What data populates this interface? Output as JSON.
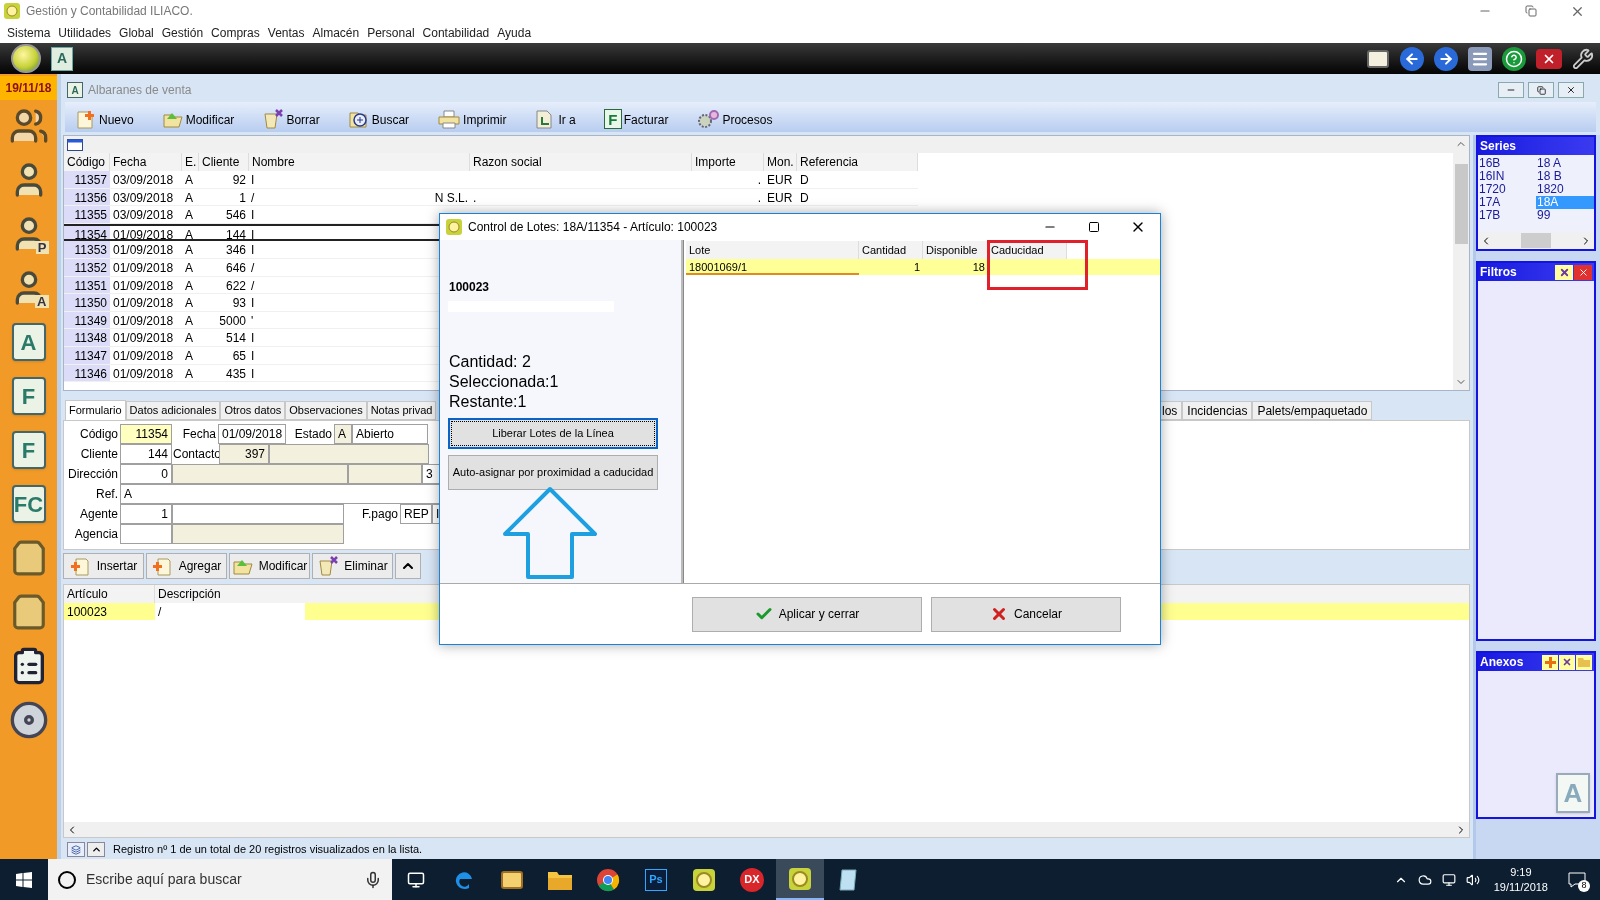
{
  "app_window": {
    "title": "Gestión y Contabilidad ILIACO."
  },
  "menu": [
    "Sistema",
    "Utilidades",
    "Global",
    "Gestión",
    "Compras",
    "Ventas",
    "Almacén",
    "Personal",
    "Contabilidad",
    "Ayuda"
  ],
  "quick_bar": {
    "module_glyph": "A"
  },
  "sidebar": {
    "date": "19/11/18",
    "items": [
      {
        "kind": "people"
      },
      {
        "kind": "person"
      },
      {
        "kind": "person",
        "glyph": "P"
      },
      {
        "kind": "person",
        "glyph": "A"
      },
      {
        "kind": "letter",
        "glyph": "A"
      },
      {
        "kind": "letter",
        "glyph": "F"
      },
      {
        "kind": "letter",
        "glyph": "F"
      },
      {
        "kind": "letter",
        "glyph": "FC"
      },
      {
        "kind": "bag"
      },
      {
        "kind": "bag"
      },
      {
        "kind": "list"
      },
      {
        "kind": "disc"
      }
    ]
  },
  "window": {
    "icon_glyph": "A",
    "title": "Albaranes de venta",
    "toolbar": [
      {
        "label": "Nuevo",
        "kind": "new"
      },
      {
        "label": "Modificar",
        "kind": "edit"
      },
      {
        "label": "Borrar",
        "kind": "delete"
      },
      {
        "label": "Buscar",
        "kind": "search"
      },
      {
        "label": "Imprimir",
        "kind": "print"
      },
      {
        "label": "Ir a",
        "kind": "goto"
      },
      {
        "label": "Facturar",
        "kind": "letter",
        "glyph": "F"
      },
      {
        "label": "Procesos",
        "kind": "process"
      }
    ]
  },
  "list": {
    "columns": [
      "Código",
      "Fecha",
      "E.",
      "Cliente",
      "Nombre",
      "Razon social",
      "Importe",
      "Mon.",
      "Referencia"
    ],
    "rows": [
      {
        "codigo": "11357",
        "fecha": "03/09/2018",
        "e": "A",
        "cliente": "92",
        "nombre": "I",
        "importe": ".",
        "mon": "EUR",
        "referencia": "D",
        "selected": false
      },
      {
        "codigo": "11356",
        "fecha": "03/09/2018",
        "e": "A",
        "cliente": "1",
        "nombre": "/",
        "nombre_tail": "N S.L.",
        "razon_social": ".",
        "importe": ".",
        "mon": "EUR",
        "referencia": "D",
        "selected": false
      },
      {
        "codigo": "11355",
        "fecha": "03/09/2018",
        "e": "A",
        "cliente": "546",
        "nombre": "I",
        "selected": false
      },
      {
        "codigo": "11354",
        "fecha": "01/09/2018",
        "e": "A",
        "cliente": "144",
        "nombre": "I",
        "selected": true
      },
      {
        "codigo": "11353",
        "fecha": "01/09/2018",
        "e": "A",
        "cliente": "346",
        "nombre": "I",
        "selected": false
      },
      {
        "codigo": "11352",
        "fecha": "01/09/2018",
        "e": "A",
        "cliente": "646",
        "nombre": "/",
        "selected": false
      },
      {
        "codigo": "11351",
        "fecha": "01/09/2018",
        "e": "A",
        "cliente": "622",
        "nombre": "/",
        "selected": false
      },
      {
        "codigo": "11350",
        "fecha": "01/09/2018",
        "e": "A",
        "cliente": "93",
        "nombre": "I",
        "selected": false
      },
      {
        "codigo": "11349",
        "fecha": "01/09/2018",
        "e": "A",
        "cliente": "5000",
        "nombre": "'",
        "selected": false
      },
      {
        "codigo": "11348",
        "fecha": "01/09/2018",
        "e": "A",
        "cliente": "514",
        "nombre": "I",
        "selected": false
      },
      {
        "codigo": "11347",
        "fecha": "01/09/2018",
        "e": "A",
        "cliente": "65",
        "nombre": "I",
        "selected": false
      },
      {
        "codigo": "11346",
        "fecha": "01/09/2018",
        "e": "A",
        "cliente": "435",
        "nombre": "I",
        "selected": false
      }
    ]
  },
  "series": {
    "title": "Series",
    "items": [
      {
        "label": "16B",
        "selected": false
      },
      {
        "label": "16IN",
        "selected": false
      },
      {
        "label": "1720",
        "selected": false
      },
      {
        "label": "17A",
        "selected": false
      },
      {
        "label": "17B",
        "selected": false
      },
      {
        "label": "18 A",
        "selected": false
      },
      {
        "label": "18 B",
        "selected": false
      },
      {
        "label": "1820",
        "selected": false
      },
      {
        "label": "18A",
        "selected": true
      },
      {
        "label": "99",
        "selected": false
      }
    ]
  },
  "filters": {
    "title": "Filtros"
  },
  "attachments": {
    "title": "Anexos",
    "glyph": "A"
  },
  "form": {
    "tabs_left": [
      {
        "label": "Formulario",
        "selected": true
      },
      {
        "label": "Datos adicionales",
        "selected": false
      },
      {
        "label": "Otros datos",
        "selected": false
      },
      {
        "label": "Observaciones",
        "selected": false
      },
      {
        "label": "Notas privad",
        "selected": false
      }
    ],
    "tabs_right": [
      {
        "label": "los",
        "selected": false
      },
      {
        "label": "Incidencias",
        "selected": false
      },
      {
        "label": "Palets/empaquetado",
        "selected": false
      }
    ],
    "codigo_label": "Código",
    "codigo": "11354",
    "fecha_label": "Fecha",
    "fecha": "01/09/2018",
    "estado_label": "Estado",
    "estado": "A",
    "estado_text": "Abierto",
    "cliente_label": "Cliente",
    "cliente": "144",
    "contacto_label": "Contacto",
    "contacto": "397",
    "direccion_label": "Dirección",
    "direccion": "0",
    "direccion_extra": "3",
    "ref_label": "Ref.",
    "ref": "A",
    "agente_label": "Agente",
    "agente": "1",
    "fpago_label": "F.pago",
    "fpago": "REP",
    "fpago_extra": "I",
    "agencia_label": "Agencia"
  },
  "line_buttons": [
    {
      "label": "Insertar",
      "kind": "insert"
    },
    {
      "label": "Agregar",
      "kind": "insert"
    },
    {
      "label": "Modificar",
      "kind": "edit"
    },
    {
      "label": "Eliminar",
      "kind": "delete"
    },
    {
      "kind": "up"
    }
  ],
  "lines": {
    "columns": [
      "Artículo",
      "Descripción"
    ],
    "rows": [
      {
        "articulo": "100023",
        "descripcion": "/",
        "selected": true
      }
    ]
  },
  "status_bar": "Registro nº 1 de un total de 20 registros visualizados en la lista.",
  "dialog": {
    "title": "Control de Lotes: 18A/11354 - Artículo: 100023",
    "article": "100023",
    "summary": [
      "Cantidad: 2",
      "Seleccionada:1",
      "Restante:1"
    ],
    "buttons": [
      {
        "label": "Liberar Lotes de la Línea",
        "focused": true
      },
      {
        "label": "Auto-asignar por proximidad a caducidad",
        "focused": false
      }
    ],
    "grid": {
      "columns": [
        "Lote",
        "Cantidad",
        "Disponible",
        "Caducidad"
      ],
      "rows": [
        {
          "lote": "18001069/1",
          "cantidad": "1",
          "disponible": "18",
          "selected": true
        }
      ]
    },
    "actions": [
      {
        "label": "Aplicar y cerrar",
        "kind": "apply"
      },
      {
        "label": "Cancelar",
        "kind": "cancel"
      }
    ]
  },
  "taskbar": {
    "search_placeholder": "Escribe aquí para buscar",
    "apps": [
      {
        "kind": "edge",
        "active": false
      },
      {
        "kind": "mail",
        "active": false
      },
      {
        "kind": "folder",
        "active": false
      },
      {
        "kind": "chrome",
        "active": false
      },
      {
        "kind": "ps",
        "glyph": "Ps",
        "active": false
      },
      {
        "kind": "app",
        "active": false
      },
      {
        "kind": "dx",
        "glyph": "DX",
        "active": false
      },
      {
        "kind": "app",
        "active": true
      },
      {
        "kind": "notes",
        "active": false
      }
    ],
    "time": "9:19",
    "date": "19/11/2018",
    "notifications": "8"
  }
}
